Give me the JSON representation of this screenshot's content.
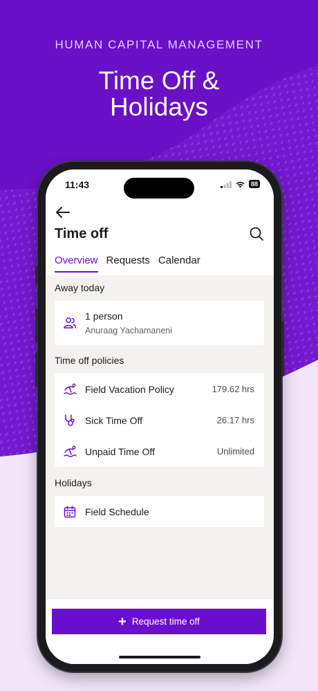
{
  "hero": {
    "subtitle": "HUMAN CAPITAL MANAGEMENT",
    "title_line1": "Time Off &",
    "title_line2": "Holidays"
  },
  "colors": {
    "brand": "#6b0fcf",
    "hero_bg": "#6a10c7",
    "page_bg": "#f3e6fb"
  },
  "status_bar": {
    "time": "11:43",
    "battery": "88"
  },
  "header": {
    "back_icon": "arrow-left-icon",
    "title": "Time off",
    "search_icon": "search-icon",
    "tabs": [
      {
        "label": "Overview",
        "active": true
      },
      {
        "label": "Requests",
        "active": false
      },
      {
        "label": "Calendar",
        "active": false
      }
    ]
  },
  "away_today": {
    "label": "Away today",
    "count_text": "1 person",
    "names": "Anuraag Yachamaneni",
    "icon": "people-icon"
  },
  "policies": {
    "label": "Time off policies",
    "items": [
      {
        "name": "Field Vacation Policy",
        "value": "179.62 hrs",
        "icon": "beach-icon"
      },
      {
        "name": "Sick Time Off",
        "value": "26.17 hrs",
        "icon": "stethoscope-icon"
      },
      {
        "name": "Unpaid Time Off",
        "value": "Unlimited",
        "icon": "beach-icon"
      }
    ]
  },
  "holidays": {
    "label": "Holidays",
    "items": [
      {
        "name": "Field Schedule",
        "icon": "calendar-icon"
      }
    ]
  },
  "cta": {
    "label": "Request time off",
    "icon": "plus-icon"
  }
}
